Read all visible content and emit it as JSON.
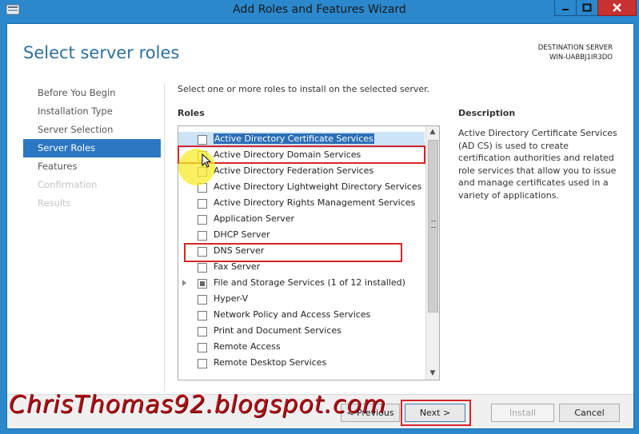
{
  "window": {
    "title": "Add Roles and Features Wizard",
    "controls": {
      "minimize": "–",
      "maximize": "□",
      "close": "✕"
    }
  },
  "page": {
    "title": "Select server roles",
    "destination_label": "DESTINATION SERVER",
    "destination_value": "WIN-UABBJ1IR3DO"
  },
  "nav": [
    {
      "label": "Before You Begin",
      "state": "normal"
    },
    {
      "label": "Installation Type",
      "state": "normal"
    },
    {
      "label": "Server Selection",
      "state": "normal"
    },
    {
      "label": "Server Roles",
      "state": "active"
    },
    {
      "label": "Features",
      "state": "normal"
    },
    {
      "label": "Confirmation",
      "state": "disabled"
    },
    {
      "label": "Results",
      "state": "disabled"
    }
  ],
  "main": {
    "instruction": "Select one or more roles to install on the selected server.",
    "roles_heading": "Roles",
    "description_heading": "Description",
    "description_text": "Active Directory Certificate Services (AD CS) is used to create certification authorities and related role services that allow you to issue and manage certificates used in a variety of applications.",
    "roles": [
      {
        "label": "Active Directory Certificate Services",
        "checked": false,
        "selected": true
      },
      {
        "label": "Active Directory Domain Services",
        "checked": false
      },
      {
        "label": "Active Directory Federation Services",
        "checked": false
      },
      {
        "label": "Active Directory Lightweight Directory Services",
        "checked": false
      },
      {
        "label": "Active Directory Rights Management Services",
        "checked": false
      },
      {
        "label": "Application Server",
        "checked": false
      },
      {
        "label": "DHCP Server",
        "checked": false
      },
      {
        "label": "DNS Server",
        "checked": false
      },
      {
        "label": "Fax Server",
        "checked": false
      },
      {
        "label": "File and Storage Services (1 of 12 installed)",
        "checked": "partial",
        "expandable": true
      },
      {
        "label": "Hyper-V",
        "checked": false
      },
      {
        "label": "Network Policy and Access Services",
        "checked": false
      },
      {
        "label": "Print and Document Services",
        "checked": false
      },
      {
        "label": "Remote Access",
        "checked": false
      },
      {
        "label": "Remote Desktop Services",
        "checked": false
      }
    ]
  },
  "footer": {
    "previous": "< Previous",
    "next": "Next >",
    "install": "Install",
    "cancel": "Cancel"
  },
  "watermark": "ChrisThomas92.blogspot.com",
  "colors": {
    "accent": "#2b88cc",
    "nav_active": "#2b77c2",
    "highlight_red": "#d8242a",
    "close_red": "#c7312f"
  }
}
